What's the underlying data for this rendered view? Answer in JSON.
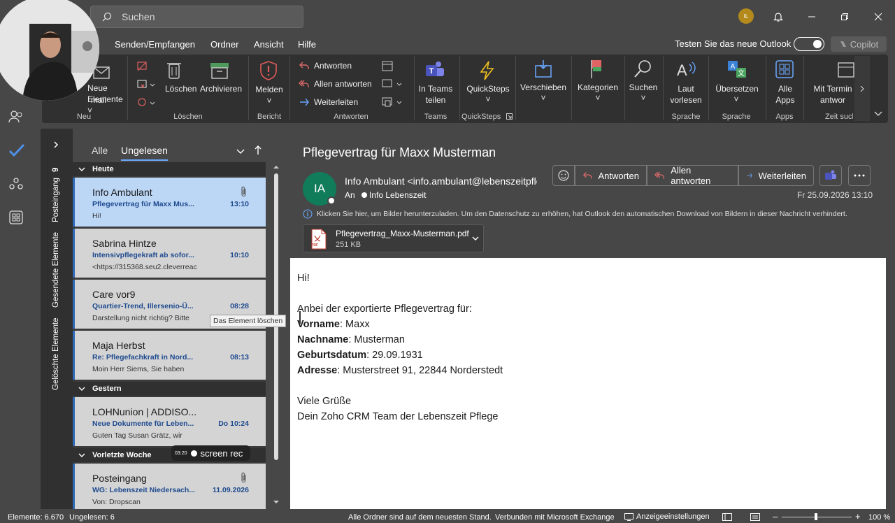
{
  "titlebar": {
    "search_placeholder": "Suchen",
    "user_initials": "IL"
  },
  "menu": {
    "items": [
      "Senden/Empfangen",
      "Ordner",
      "Ansicht",
      "Hilfe"
    ],
    "try_new": "Testen Sie das neue Outlook",
    "copilot": "Copilot"
  },
  "ribbon": {
    "neue_elemente": "Neue Elemente",
    "email_partial": "mail",
    "loeschen": "Löschen",
    "archivieren": "Archivieren",
    "melden": "Melden",
    "antworten": "Antworten",
    "allen_antworten": "Allen antworten",
    "weiterleiten": "Weiterleiten",
    "in_teams_teilen": "In Teams teilen",
    "quicksteps": "QuickSteps",
    "verschieben": "Verschieben",
    "kategorien": "Kategorien",
    "suchen": "Suchen",
    "laut_vorlesen": "Laut vorlesen",
    "uebersetzen": "Übersetzen",
    "alle_apps": "Alle Apps",
    "mit_terminal": "Mit Termin antwor",
    "groups": {
      "neu": "Neu",
      "loeschen": "Löschen",
      "bericht": "Bericht",
      "antworten": "Antworten",
      "teams": "Teams",
      "quicksteps": "QuickSteps",
      "sprache1": "Sprache",
      "sprache2": "Sprache",
      "apps": "Apps",
      "zeit": "Zeit such"
    }
  },
  "folders": {
    "posteingang": "Posteingang",
    "posteingang_count": "9",
    "gesendet": "Gesendete Elemente",
    "geloescht": "Gelöschte Elemente"
  },
  "list": {
    "filter_all": "Alle",
    "filter_unread": "Ungelesen",
    "groups": [
      "Heute",
      "Gestern",
      "Vorletzte Woche"
    ],
    "mails": [
      {
        "from": "Info Ambulant",
        "subject": "Pflegevertrag für Maxx Mus...",
        "time": "13:10",
        "preview": "Hi!"
      },
      {
        "from": "Sabrina Hintze",
        "subject": "Intensivpflegekraft ab sofor...",
        "time": "10:10",
        "preview": "<https://315368.seu2.cleverreac"
      },
      {
        "from": "Care vor9",
        "subject": "Quartier-Trend, Illersenio-Ü...",
        "time": "08:28",
        "preview": "Darstellung nicht richtig? Bitte"
      },
      {
        "from": "Maja Herbst",
        "subject": "Re: Pflegefachkraft in Nord...",
        "time": "08:13",
        "preview": "Moin Herr Siems,  Sie haben"
      },
      {
        "from": "LOHNunion | ADDISO...",
        "subject": "Neue Dokumente für Leben...",
        "time": "Do 10:24",
        "preview": "Guten Tag Susan Grätz,  wir"
      },
      {
        "from": "Posteingang",
        "subject": "WG: Lebenszeit Niedersach...",
        "time": "11.09.2026",
        "preview": "Von: Dropscan"
      }
    ],
    "tooltip": "Das Element löschen"
  },
  "reading": {
    "subject": "Pflegevertrag für Maxx Musterman",
    "avatar": "IA",
    "from": "Info Ambulant <info.ambulant@lebenszeitpflege.de>",
    "to_label": "An",
    "to": "Info Lebenszeit",
    "reply": "Antworten",
    "reply_all": "Allen antworten",
    "forward": "Weiterleiten",
    "date": "Fr 25.09.2026 13:10",
    "info": "Klicken Sie hier, um Bilder herunterzuladen. Um den Datenschutz zu erhöhen, hat Outlook den automatischen Download von Bildern in dieser Nachricht verhindert.",
    "attachment_name": "Pflegevertrag_Maxx-Musterman.pdf",
    "attachment_size": "251 KB",
    "pdf_label": "PDF",
    "greeting": "Hi!",
    "intro": "Anbei der exportierte Pflegevertrag für:",
    "fields": [
      {
        "label": "Vorname",
        "sep": ": ",
        "value": "Maxx"
      },
      {
        "label": "Nachname",
        "sep": ": ",
        "value": "Musterman"
      },
      {
        "label": "Geburtsdatum",
        "sep": ": ",
        "value": "29.09.1931"
      },
      {
        "label": "Adresse",
        "sep": ": ",
        "value": "Musterstreet 91, 22844 Norderstedt"
      }
    ],
    "closing": "Viele Grüße",
    "signature": "Dein Zoho CRM Team der Lebenszeit Pflege"
  },
  "status": {
    "elements": "Elemente: 6.670",
    "unread": "Ungelesen: 6",
    "folders_state": "Alle Ordner sind auf dem neuesten Stand.",
    "connected": "Verbunden mit Microsoft Exchange",
    "display": "Anzeigeeinstellungen",
    "zoom": "100 %"
  },
  "overlay": {
    "rec_time": "03:20",
    "rec_label": "screen rec"
  }
}
